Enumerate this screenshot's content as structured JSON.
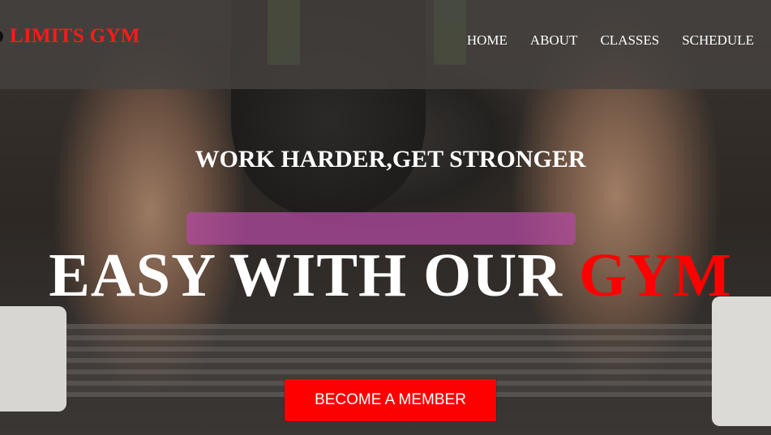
{
  "brand": {
    "name": "LIMITS GYM",
    "color": "#ff1a1a"
  },
  "nav": {
    "items": [
      "HOME",
      "ABOUT",
      "CLASSES",
      "SCHEDULE"
    ]
  },
  "hero": {
    "tagline": "WORK HARDER,GET STRONGER",
    "headline_main": "EASY WITH OUR",
    "headline_accent": "GYM",
    "cta_label": "BECOME A MEMBER",
    "accent_color": "#ff0000",
    "background_icon": "weightlifter-photo"
  }
}
